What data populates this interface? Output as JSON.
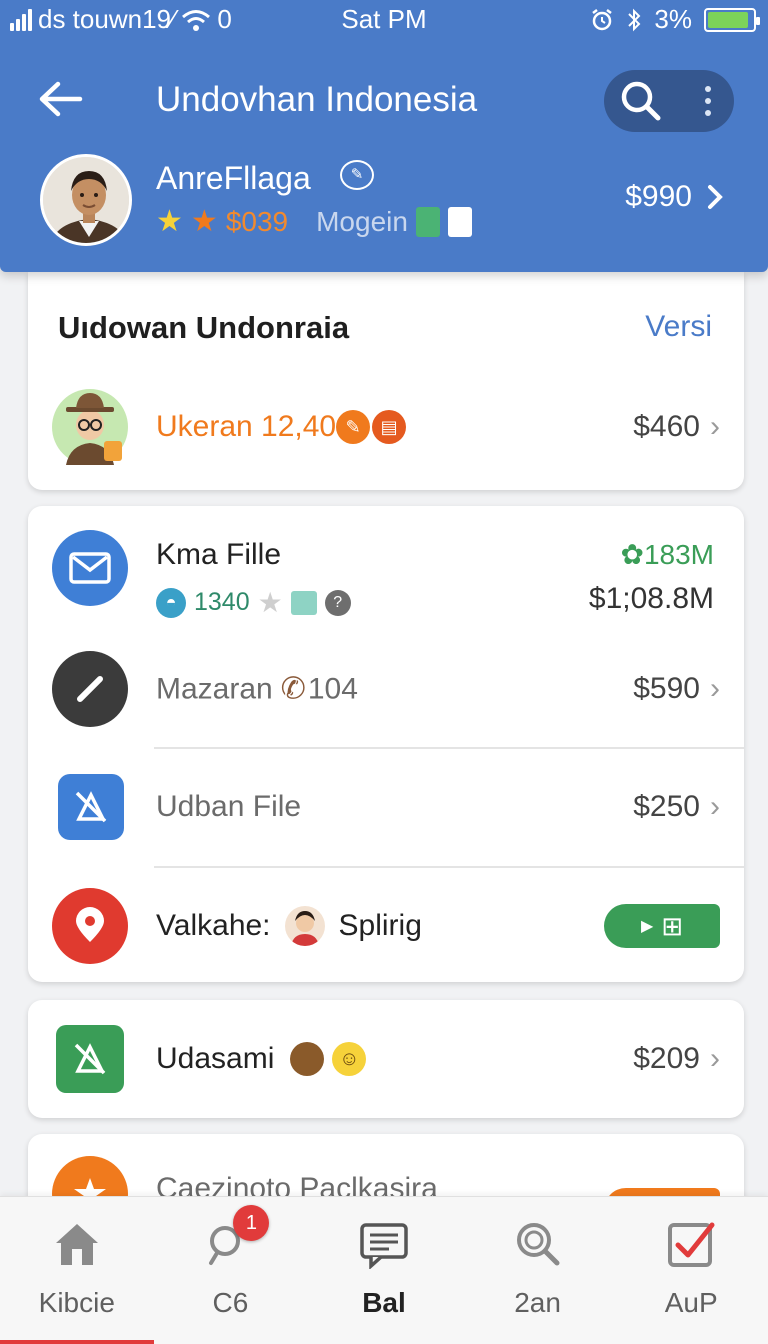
{
  "status_bar": {
    "carrier": "ds touwn19⁄",
    "wifi_suffix": "0",
    "time": "Sat PM",
    "battery": "3%",
    "battery_level": 0.9
  },
  "header": {
    "title": "Undovhan Indonesia",
    "user_name": "AnreFllaga",
    "meta_price": "$039",
    "meta_label": "Mogein",
    "amount": "$990"
  },
  "section": {
    "title": "Uıdowan Undonraia",
    "link": "Versi",
    "featured": {
      "label": "Ukeran 12,40",
      "amount": "$460"
    }
  },
  "list": [
    {
      "label": "Kma Fille",
      "sub_value": "1340",
      "top_value": "183M",
      "amount": "$1;08.8M"
    },
    {
      "label": "Mazaran",
      "label_suffix": "104",
      "amount": "$590"
    },
    {
      "label": "Udban File",
      "amount": "$250"
    },
    {
      "label": "Valkahe:",
      "label_suffix": "Splirig"
    }
  ],
  "single_row": {
    "label": "Udasami",
    "amount": "$209"
  },
  "partial_row": {
    "label": "Caezinoto Paclkasira"
  },
  "colors": {
    "header": "#4a7bc8",
    "accent_orange": "#f07a1d",
    "accent_green": "#3a9d57",
    "badge_red": "#e13b3b"
  },
  "bottom_nav": [
    {
      "label": "Kibcie",
      "icon": "home-icon"
    },
    {
      "label": "C6",
      "icon": "chat-search-icon",
      "badge": "1"
    },
    {
      "label": "Bal",
      "icon": "message-list-icon",
      "active": true
    },
    {
      "label": "2an",
      "icon": "search-icon"
    },
    {
      "label": "AuP",
      "icon": "checkbox-icon"
    }
  ]
}
